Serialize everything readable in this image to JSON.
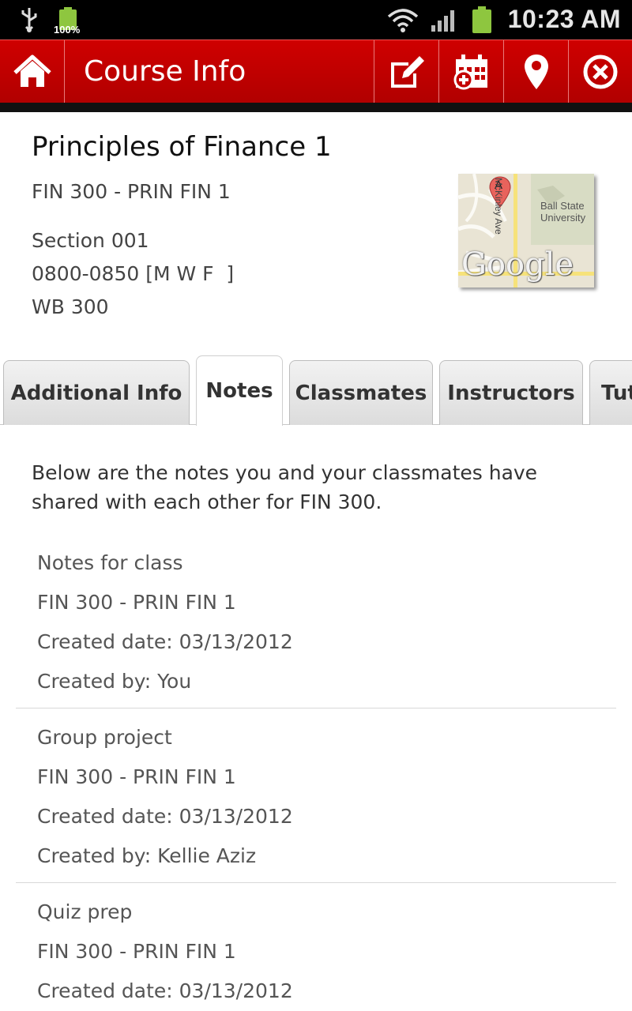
{
  "status_bar": {
    "battery_percent": "100%",
    "time": "10:23 AM",
    "icons": [
      "usb-icon",
      "battery-full-icon",
      "wifi-icon",
      "signal-icon",
      "battery-icon"
    ]
  },
  "toolbar": {
    "title": "Course Info",
    "buttons": [
      "home-icon",
      "compose-note-icon",
      "add-calendar-icon",
      "location-pin-icon",
      "close-icon"
    ],
    "colors": {
      "bar": "#c40000",
      "text": "#ffffff"
    }
  },
  "course": {
    "title": "Principles of Finance 1",
    "code": "FIN 300 - PRIN FIN 1",
    "section": "Section 001",
    "time": "0800-0850 [M W F  ]",
    "room": "WB 300"
  },
  "map": {
    "street": "McKinley Ave",
    "place_line1": "Ball State",
    "place_line2": "University",
    "marker": "A",
    "brand": "Google"
  },
  "tabs": [
    {
      "label": "Additional Info",
      "active": false
    },
    {
      "label": "Notes",
      "active": true
    },
    {
      "label": "Classmates",
      "active": false
    },
    {
      "label": "Instructors",
      "active": false
    },
    {
      "label": "Tutors",
      "active": false
    }
  ],
  "notes_intro": "Below are the notes you and your classmates have shared with each other for FIN 300.",
  "notes": [
    {
      "title": "Notes for class",
      "course": "FIN 300 - PRIN FIN 1",
      "created_date": "Created date: 03/13/2012",
      "created_by": "Created by: You"
    },
    {
      "title": "Group project",
      "course": "FIN 300 - PRIN FIN 1",
      "created_date": "Created date: 03/13/2012",
      "created_by": "Created by: Kellie Aziz"
    },
    {
      "title": "Quiz prep",
      "course": "FIN 300 - PRIN FIN 1",
      "created_date": "Created date: 03/13/2012",
      "created_by": ""
    }
  ]
}
